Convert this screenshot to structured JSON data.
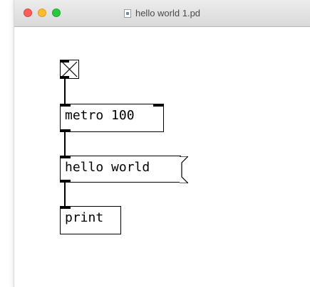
{
  "window": {
    "title": "hello world 1.pd"
  },
  "patch": {
    "metro_label": "metro 100",
    "message_label": "hello world",
    "print_label": "print"
  }
}
